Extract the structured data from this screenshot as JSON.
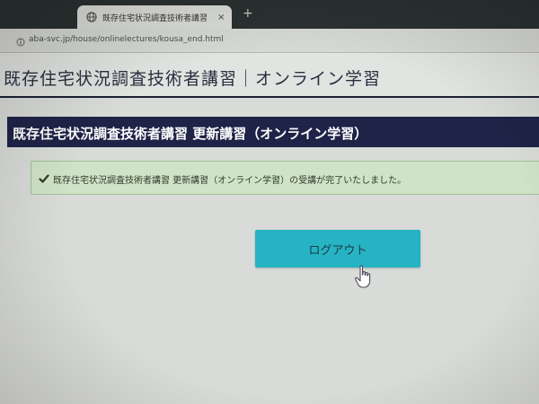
{
  "browser": {
    "tab": {
      "title": "既存住宅状況調査技術者講習",
      "close": "×"
    },
    "new_tab": "+",
    "address": {
      "url": "aba-svc.jp/house/onlinelectures/kousa_end.html"
    }
  },
  "header": {
    "title": "既存住宅状況調査技術者講習｜オンライン学習"
  },
  "section": {
    "title": "既存住宅状況調査技術者講習 更新講習（オンライン学習）"
  },
  "alert": {
    "message": "既存住宅状況調査技術者講習 更新講習（オンライン学習）の受講が完了いたしました。",
    "icon": "check-icon",
    "color": "#cfe3c8"
  },
  "logout": {
    "label": "ログアウト",
    "color": "#26b3c4"
  },
  "colors": {
    "header_bar": "#1f2347",
    "alert_bg": "#cfe3c8",
    "button": "#26b3c4"
  }
}
